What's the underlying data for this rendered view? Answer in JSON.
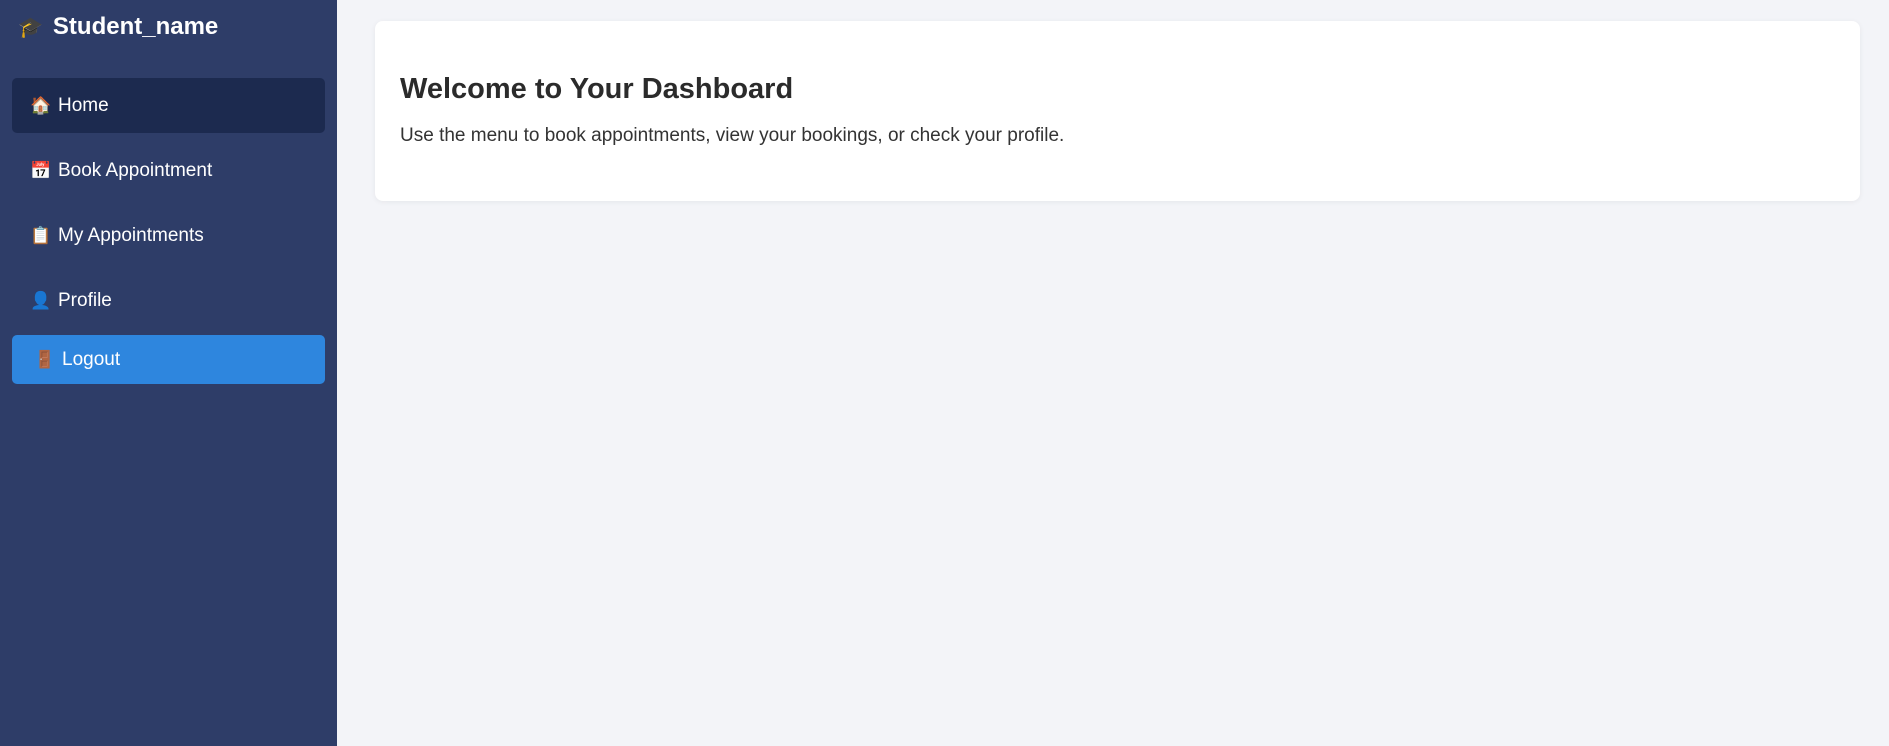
{
  "sidebar": {
    "brand": {
      "icon": "graduation-cap-icon",
      "glyph": "🎓",
      "title": "Student_name"
    },
    "items": [
      {
        "icon": "house-icon",
        "glyph": "🏠",
        "label": "Home",
        "active": true
      },
      {
        "icon": "calendar-icon",
        "glyph": "📅",
        "label": "Book Appointment"
      },
      {
        "icon": "clipboard-icon",
        "glyph": "📋",
        "label": "My Appointments"
      },
      {
        "icon": "person-icon",
        "glyph": "👤",
        "label": "Profile"
      }
    ],
    "logout": {
      "icon": "door-icon",
      "glyph": "🚪",
      "label": "Logout"
    }
  },
  "main": {
    "title": "Welcome to Your Dashboard",
    "description": "Use the menu to book appointments, view your bookings, or check your profile."
  },
  "colors": {
    "sidebar_bg": "#2e3d68",
    "active_item_bg": "#1c2a4f",
    "logout_bg": "#2e86de",
    "page_bg": "#f3f4f8"
  }
}
